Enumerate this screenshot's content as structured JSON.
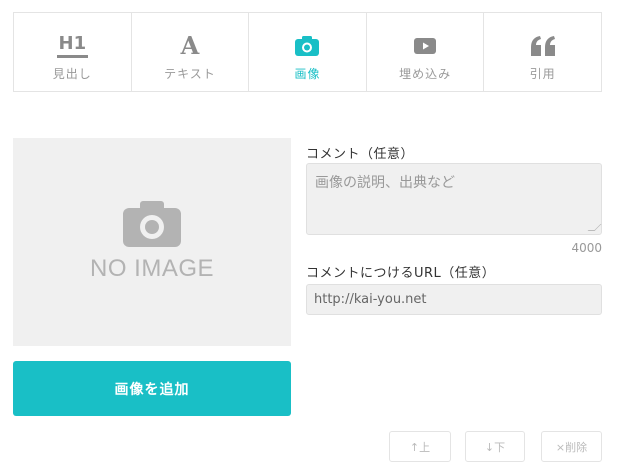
{
  "colors": {
    "accent": "#19bfc6",
    "icon_gray": "#8a8a8a"
  },
  "tabs": [
    {
      "icon": "h1-icon",
      "icon_text": "H1",
      "label": "見出し"
    },
    {
      "icon": "text-a-icon",
      "icon_text": "A",
      "label": "テキスト"
    },
    {
      "icon": "camera-icon",
      "label": "画像",
      "active": true
    },
    {
      "icon": "video-play-icon",
      "label": "埋め込み"
    },
    {
      "icon": "quote-icon",
      "label": "引用"
    }
  ],
  "image_panel": {
    "placeholder_text": "NO IMAGE",
    "add_button_label": "画像を追加"
  },
  "comment": {
    "label": "コメント（任意）",
    "placeholder": "画像の説明、出典など",
    "counter": "4000"
  },
  "url": {
    "label": "コメントにつけるURL（任意）",
    "value": "http://kai-you.net"
  },
  "actions": {
    "up_label": "↑上",
    "down_label": "↓下",
    "delete_label": "×削除"
  }
}
